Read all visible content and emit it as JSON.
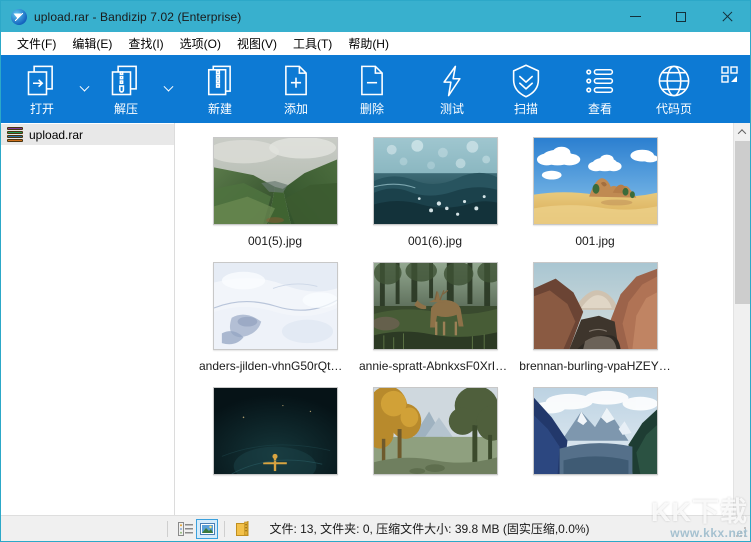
{
  "window": {
    "title": "upload.rar - Bandizip 7.02 (Enterprise)",
    "app_icon": "bandizip-logo-icon",
    "minimize_label": "─",
    "maximize_label": "□",
    "close_label": "✕",
    "titlebar_color": "#38b0ce"
  },
  "menubar": {
    "items": [
      {
        "label": "文件(F)",
        "name": "menu-file"
      },
      {
        "label": "编辑(E)",
        "name": "menu-edit"
      },
      {
        "label": "查找(I)",
        "name": "menu-find"
      },
      {
        "label": "选项(O)",
        "name": "menu-options"
      },
      {
        "label": "视图(V)",
        "name": "menu-view"
      },
      {
        "label": "工具(T)",
        "name": "menu-tools"
      },
      {
        "label": "帮助(H)",
        "name": "menu-help"
      }
    ]
  },
  "toolbar": {
    "background": "#0d7ad4",
    "buttons": [
      {
        "label": "打开",
        "icon": "open-archive-icon",
        "has_dropdown": true
      },
      {
        "label": "解压",
        "icon": "extract-icon",
        "has_dropdown": true
      },
      {
        "label": "新建",
        "icon": "new-archive-icon",
        "has_dropdown": false
      },
      {
        "label": "添加",
        "icon": "add-file-icon",
        "has_dropdown": false
      },
      {
        "label": "删除",
        "icon": "delete-file-icon",
        "has_dropdown": false
      },
      {
        "label": "测试",
        "icon": "test-lightning-icon",
        "has_dropdown": false
      },
      {
        "label": "扫描",
        "icon": "scan-shield-icon",
        "has_dropdown": false
      },
      {
        "label": "查看",
        "icon": "view-list-icon",
        "has_dropdown": false
      },
      {
        "label": "代码页",
        "icon": "codepage-globe-icon",
        "has_dropdown": false
      }
    ],
    "corner_icon": "expand-panel-icon"
  },
  "sidebar": {
    "tree": [
      {
        "label": "upload.rar",
        "icon": "rar-archive-icon",
        "selected": true
      }
    ]
  },
  "files": [
    {
      "name": "001(5).jpg",
      "thumb": "green-valley"
    },
    {
      "name": "001(6).jpg",
      "thumb": "ocean-waves"
    },
    {
      "name": "001.jpg",
      "thumb": "desert-sky"
    },
    {
      "name": "anders-jilden-vhnG50rQtU…",
      "thumb": "snow-aerial"
    },
    {
      "name": "annie-spratt-AbnkxsF0XrI-…",
      "thumb": "deer-forest"
    },
    {
      "name": "brennan-burling-vpaHZEY…",
      "thumb": "red-canyon"
    },
    {
      "name": "",
      "thumb": "night-figure"
    },
    {
      "name": "",
      "thumb": "autumn-trees"
    },
    {
      "name": "",
      "thumb": "blue-mountains"
    }
  ],
  "scrollbar": {
    "up_arrow": "chevron-up-icon",
    "down_arrow": "chevron-down-icon"
  },
  "statusbar": {
    "view_details_icon": "details-view-icon",
    "view_thumbnail_icon": "thumbnail-view-icon",
    "archive_icon": "archive-folder-icon",
    "info": "文件: 13, 文件夹: 0, 压缩文件大小: 39.8 MB (固实压缩,0.0%)",
    "resize_grip": "resize-grip-icon"
  },
  "watermark": {
    "big": "KK下载",
    "small": "www.kkx.net"
  }
}
